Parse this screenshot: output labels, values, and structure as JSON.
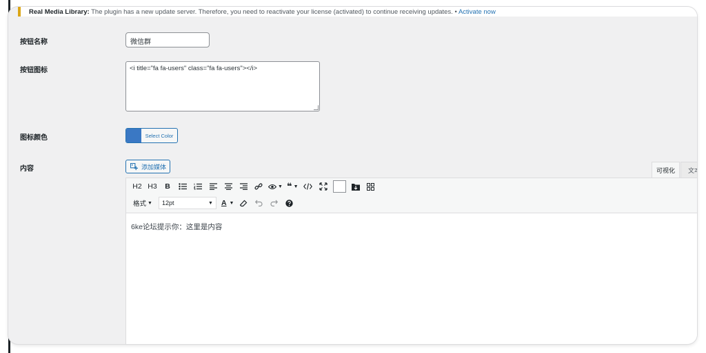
{
  "notice": {
    "plugin": "Real Media Library:",
    "message": " The plugin has a new update server. Therefore, you need to reactivate your license (activated) to continue receiving updates. • ",
    "link": "Activate now"
  },
  "fields": {
    "button_name": {
      "label": "按钮名称",
      "value": "微信群"
    },
    "button_icon": {
      "label": "按钮图标",
      "value": "<i title=\"fa fa-users\" class=\"fa fa-users\"></i>"
    },
    "icon_color": {
      "label": "图标颜色",
      "button_label": "Select Color",
      "swatch": "#3a78c4"
    },
    "content": {
      "label": "内容"
    }
  },
  "editor": {
    "add_media_label": "添加媒体",
    "tabs": [
      "可视化",
      "文本"
    ],
    "toolbar_row1": [
      "H2",
      "H3",
      "B"
    ],
    "format_label": "格式",
    "font_size": "12pt",
    "text_color_letter": "A",
    "body_text": "6ke论坛提示你：这里是内容"
  },
  "icons": {
    "toolbar": [
      "bold",
      "bullet-list",
      "numbered-list",
      "align-left",
      "align-center",
      "align-right",
      "link",
      "visibility",
      "blockquote",
      "code",
      "fullscreen",
      "color-box",
      "insert-folder",
      "grid",
      "text-color",
      "eraser",
      "undo",
      "redo",
      "help"
    ]
  }
}
